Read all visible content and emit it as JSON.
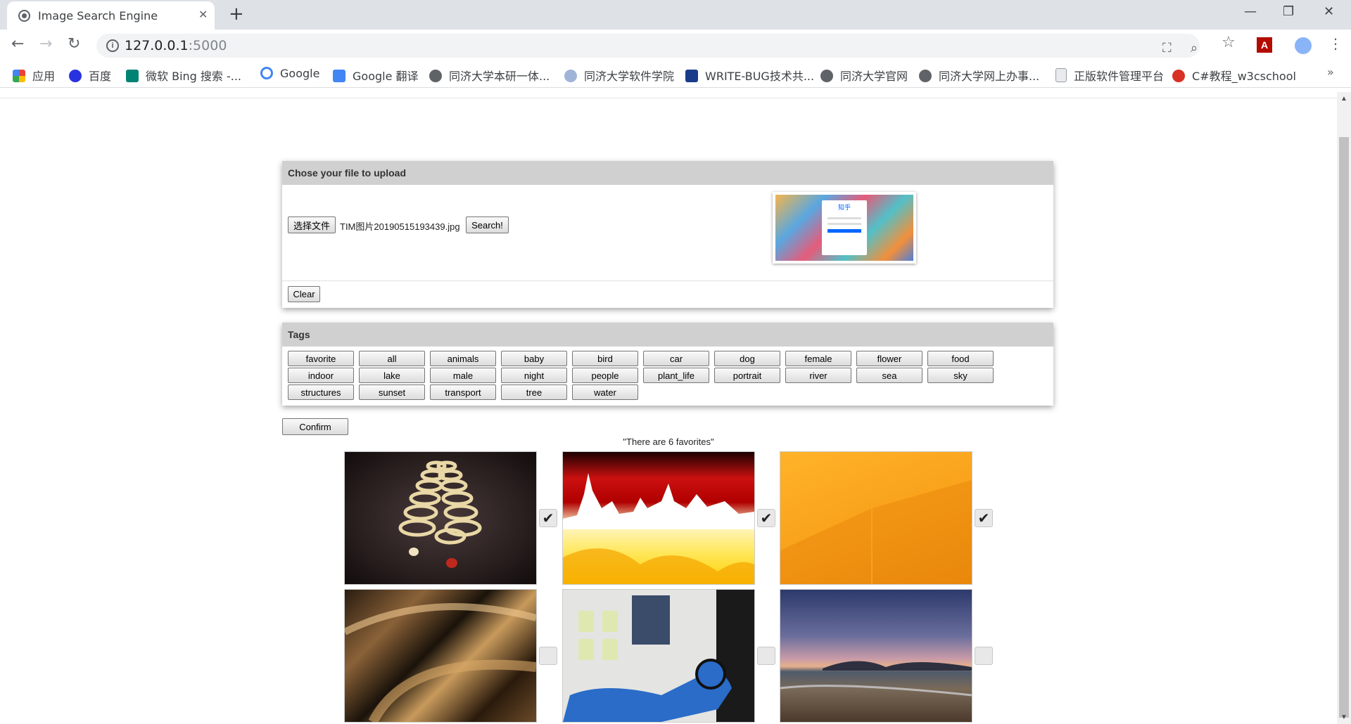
{
  "browser": {
    "tab_title": "Image Search Engine",
    "tab_close": "✕",
    "new_tab": "+",
    "url_host": "127.0.0.1",
    "url_port": ":5000",
    "window_controls": [
      "—",
      "❐",
      "✕"
    ],
    "nav_icons": [
      "back-icon",
      "forward-icon",
      "reload-icon"
    ],
    "bookmarks": [
      {
        "label": "应用",
        "icon": "apps-icon"
      },
      {
        "label": "百度",
        "icon": "baidu-icon"
      },
      {
        "label": "微软 Bing 搜索 -...",
        "icon": "bing-icon"
      },
      {
        "label": "Google",
        "icon": "google-icon"
      },
      {
        "label": "Google 翻译",
        "icon": "translate-icon"
      },
      {
        "label": "同济大学本研一体...",
        "icon": "globe-icon"
      },
      {
        "label": "同济大学软件学院",
        "icon": "tongji-icon"
      },
      {
        "label": "WRITE-BUG技术共...",
        "icon": "writebug-icon"
      },
      {
        "label": "同济大学官网",
        "icon": "globe-icon"
      },
      {
        "label": "同济大学网上办事...",
        "icon": "globe-icon"
      },
      {
        "label": "正版软件管理平台",
        "icon": "document-icon"
      },
      {
        "label": "C#教程_w3cschool",
        "icon": "w3c-icon"
      }
    ],
    "bookmarks_more": "»"
  },
  "upload": {
    "header": "Chose your file to upload",
    "choose_button": "选择文件",
    "filename": "TIM图片20190515193439.jpg",
    "search_button": "Search!",
    "clear_button": "Clear",
    "preview_caption": "知乎"
  },
  "tags": {
    "header": "Tags",
    "items": [
      "favorite",
      "all",
      "animals",
      "baby",
      "bird",
      "car",
      "dog",
      "female",
      "flower",
      "food",
      "indoor",
      "lake",
      "male",
      "night",
      "people",
      "plant_life",
      "portrait",
      "river",
      "sea",
      "sky",
      "structures",
      "sunset",
      "transport",
      "tree",
      "water"
    ]
  },
  "confirm_button": "Confirm",
  "favorites_text": "\"There are 6 favorites\"",
  "results": [
    {
      "name": "result-image-1",
      "desc": "circles-on-floor",
      "checked": true,
      "checkmark": "✔"
    },
    {
      "name": "result-image-2",
      "desc": "red-yellow-city",
      "checked": true,
      "checkmark": "✔"
    },
    {
      "name": "result-image-3",
      "desc": "orange-wall",
      "checked": true,
      "checkmark": "✔"
    },
    {
      "name": "result-image-4",
      "desc": "golden-curves",
      "checked": false,
      "checkmark": ""
    },
    {
      "name": "result-image-5",
      "desc": "blue-graffiti",
      "checked": false,
      "checkmark": ""
    },
    {
      "name": "result-image-6",
      "desc": "beach-sunset",
      "checked": false,
      "checkmark": ""
    }
  ]
}
